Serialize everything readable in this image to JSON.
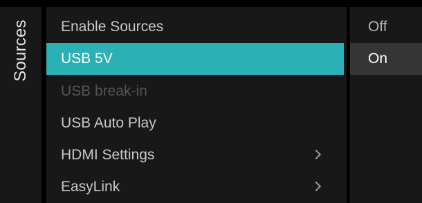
{
  "panel_title": "Sources",
  "menu": {
    "items": [
      {
        "label": "Enable Sources"
      },
      {
        "label": "USB 5V"
      },
      {
        "label": "USB break-in"
      },
      {
        "label": "USB Auto Play"
      },
      {
        "label": "HDMI Settings"
      },
      {
        "label": "EasyLink"
      }
    ],
    "selected_label": "USB 5V"
  },
  "options": {
    "items": [
      {
        "label": "Off"
      },
      {
        "label": "On"
      }
    ],
    "current_value": "On"
  },
  "colors": {
    "accent": "#2bb1b5",
    "panel_bg": "#181818",
    "background": "#000000",
    "option_highlight": "#353535",
    "disabled_text": "#555555"
  },
  "icons": {
    "submenu": "chevron-right-icon"
  }
}
